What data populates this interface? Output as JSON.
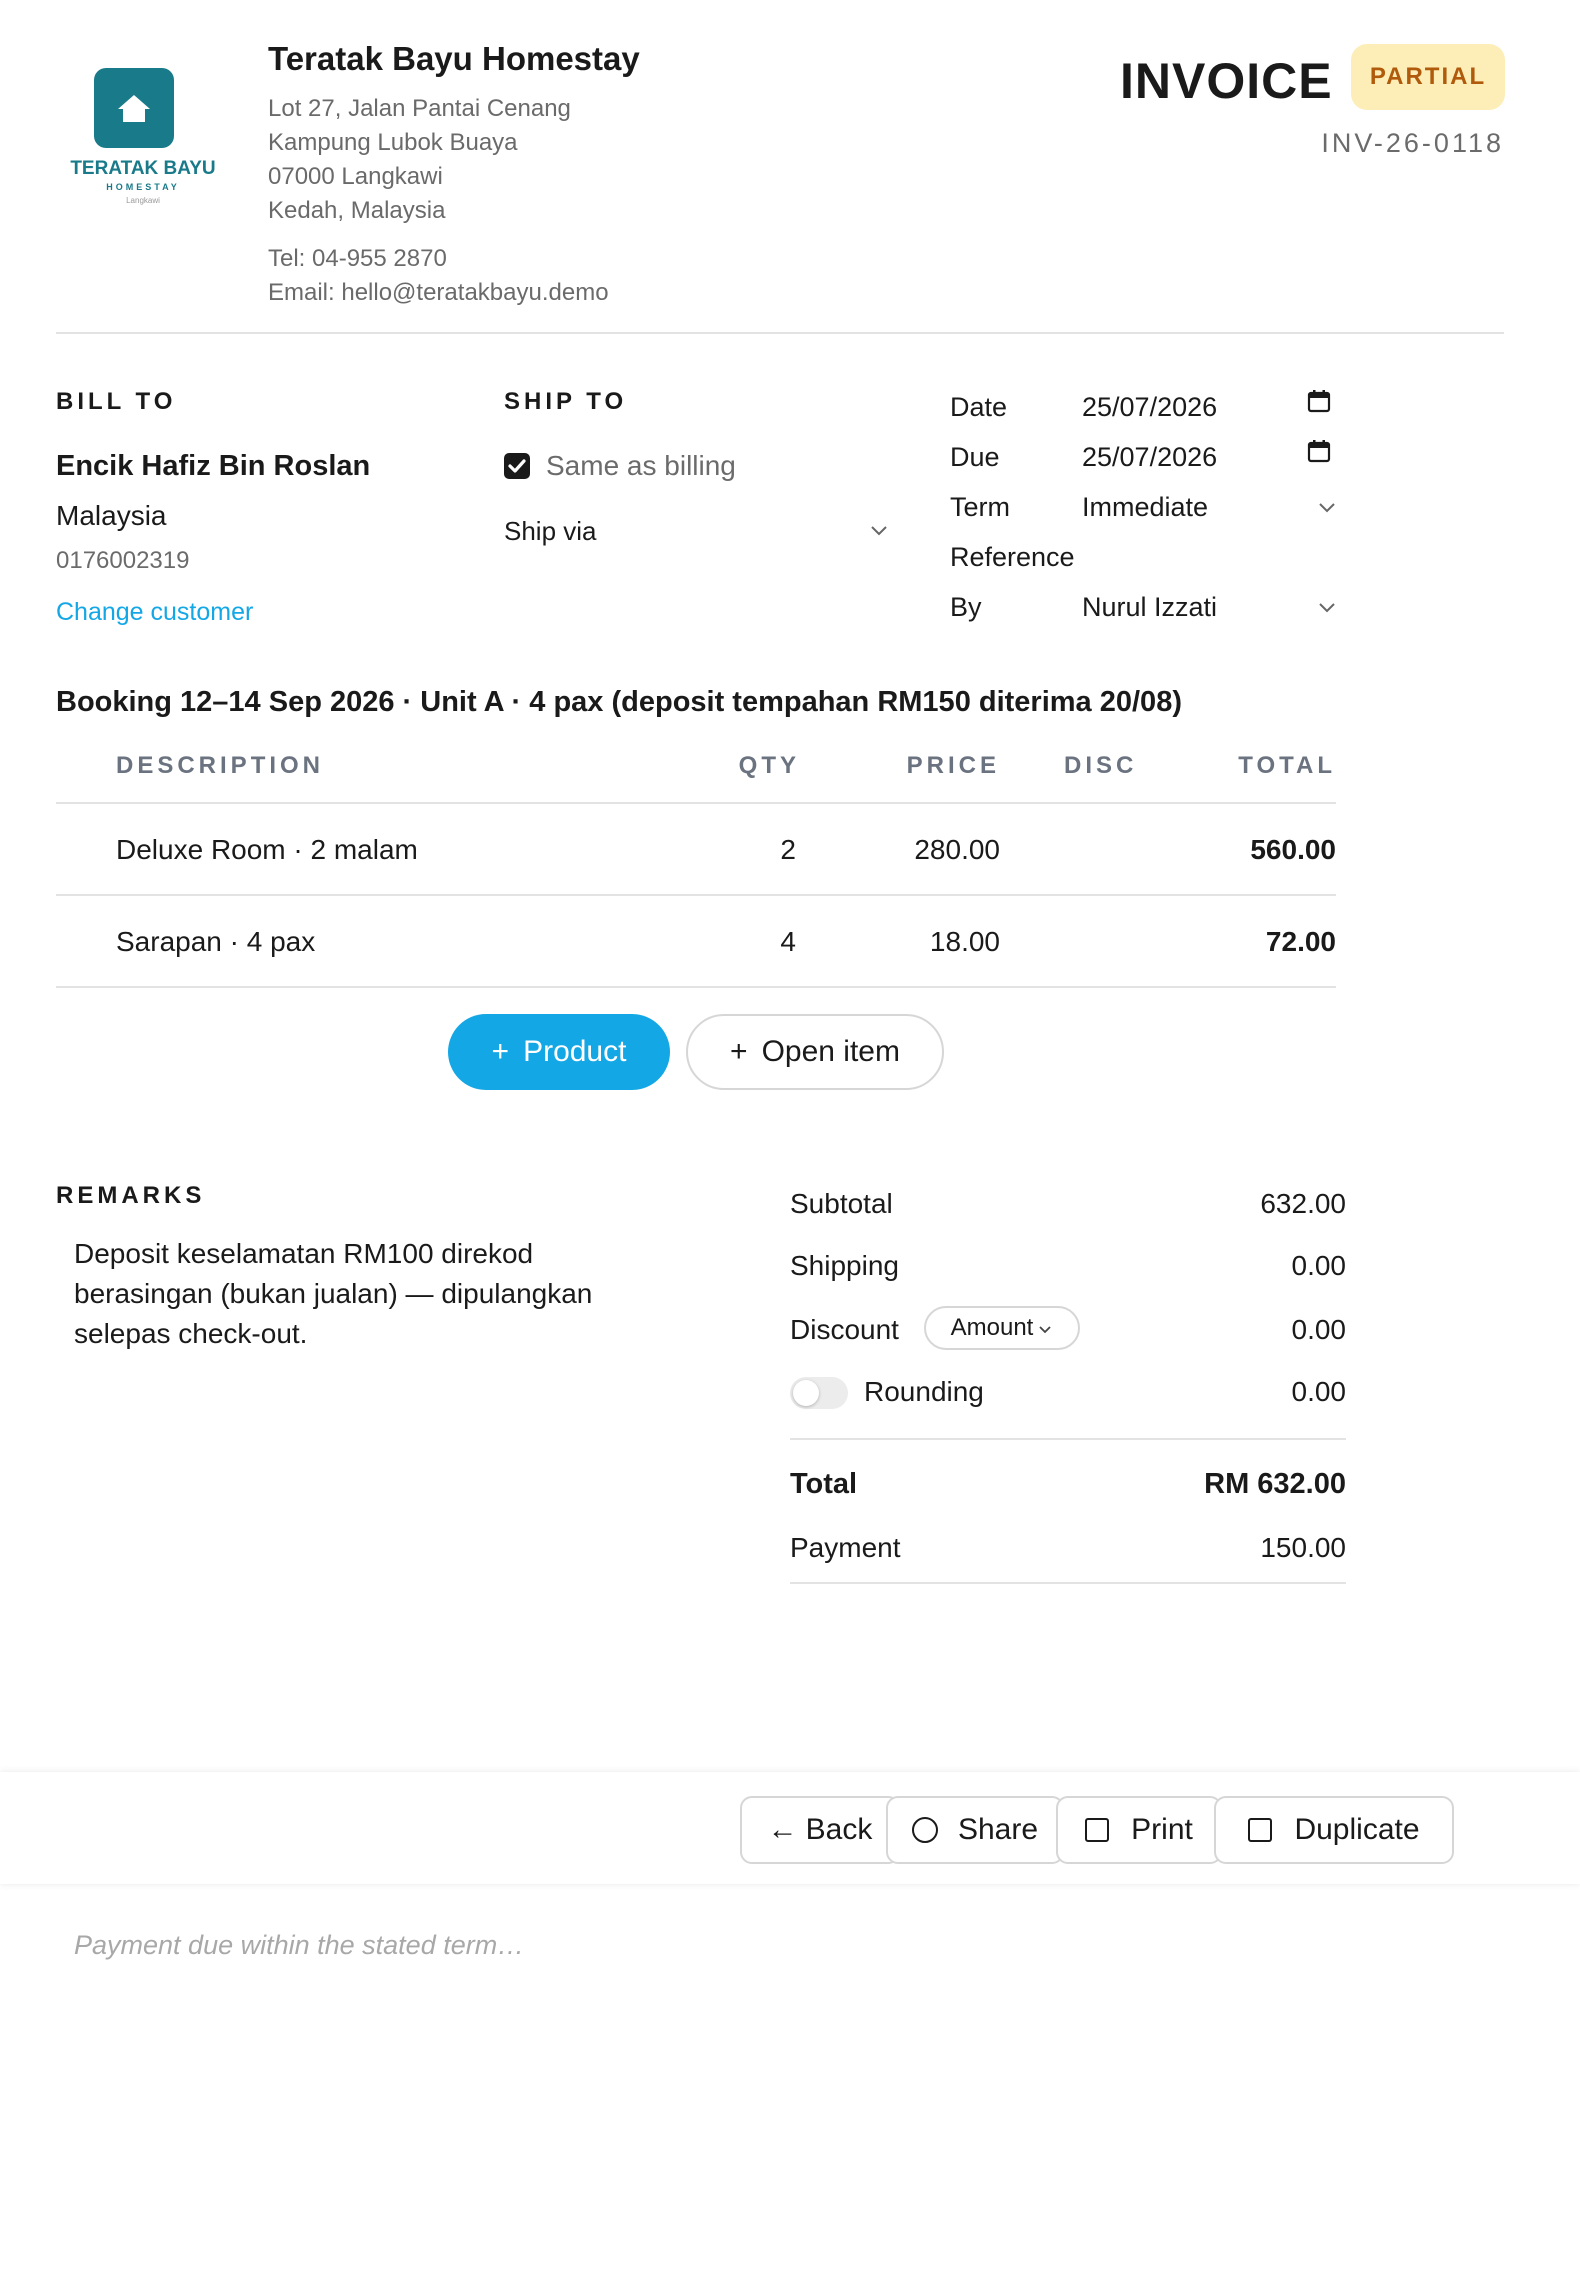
{
  "company": {
    "logo_name": "TERATAK BAYU",
    "logo_sub": "HOMESTAY",
    "logo_city": "Langkawi",
    "name": "Teratak Bayu Homestay",
    "address": [
      "Lot 27, Jalan Pantai Cenang",
      "Kampung Lubok Buaya",
      "07000 Langkawi",
      "Kedah, Malaysia"
    ],
    "tel": "Tel: 04-955 2870",
    "email": "Email: hello@teratakbayu.demo"
  },
  "invoice": {
    "title": "INVOICE",
    "status": "PARTIAL",
    "number": "INV-26-0118"
  },
  "bill_to": {
    "heading": "BILL TO",
    "name": "Encik Hafiz Bin Roslan",
    "country": "Malaysia",
    "phone": "0176002319",
    "change_link": "Change customer"
  },
  "ship_to": {
    "heading": "SHIP TO",
    "same_as_billing": "Same as billing",
    "same_checked": true,
    "ship_via": "Ship via"
  },
  "meta": {
    "date_label": "Date",
    "date_value": "25/07/2026",
    "due_label": "Due",
    "due_value": "25/07/2026",
    "term_label": "Term",
    "term_value": "Immediate",
    "reference_label": "Reference",
    "by_label": "By",
    "by_value": "Nurul Izzati"
  },
  "booking_note": "Booking 12–14 Sep 2026 · Unit A · 4 pax (deposit tempahan RM150 diterima 20/08)",
  "table": {
    "headers": {
      "description": "DESCRIPTION",
      "qty": "QTY",
      "price": "PRICE",
      "disc": "DISC",
      "total": "TOTAL"
    },
    "rows": [
      {
        "description": "Deluxe Room · 2 malam",
        "qty": "2",
        "price": "280.00",
        "disc": "",
        "total": "560.00"
      },
      {
        "description": "Sarapan · 4 pax",
        "qty": "4",
        "price": "18.00",
        "disc": "",
        "total": "72.00"
      }
    ]
  },
  "add_buttons": {
    "product": "Product",
    "open_item": "Open item"
  },
  "remarks": {
    "heading": "REMARKS",
    "lines": [
      "Deposit keselamatan RM100 direkod",
      "berasingan (bukan jualan) — dipulangkan",
      "selepas check-out."
    ]
  },
  "summary": {
    "subtotal_label": "Subtotal",
    "subtotal": "632.00",
    "shipping_label": "Shipping",
    "shipping": "0.00",
    "discount_label": "Discount",
    "discount_type": "Amount",
    "discount": "0.00",
    "rounding_label": "Rounding",
    "rounding": "0.00",
    "rounding_on": false,
    "total_label": "Total",
    "total": "RM 632.00",
    "payment_label": "Payment",
    "payment": "150.00"
  },
  "actions": {
    "back": "Back",
    "share": "Share",
    "print": "Print",
    "duplicate": "Duplicate"
  },
  "footer_placeholder": "Payment due within the stated term…",
  "colors": {
    "accent": "#14a7e6",
    "logo_teal": "#197a8a",
    "badge_bg": "#fdeeb8",
    "badge_text": "#b05a0c"
  }
}
